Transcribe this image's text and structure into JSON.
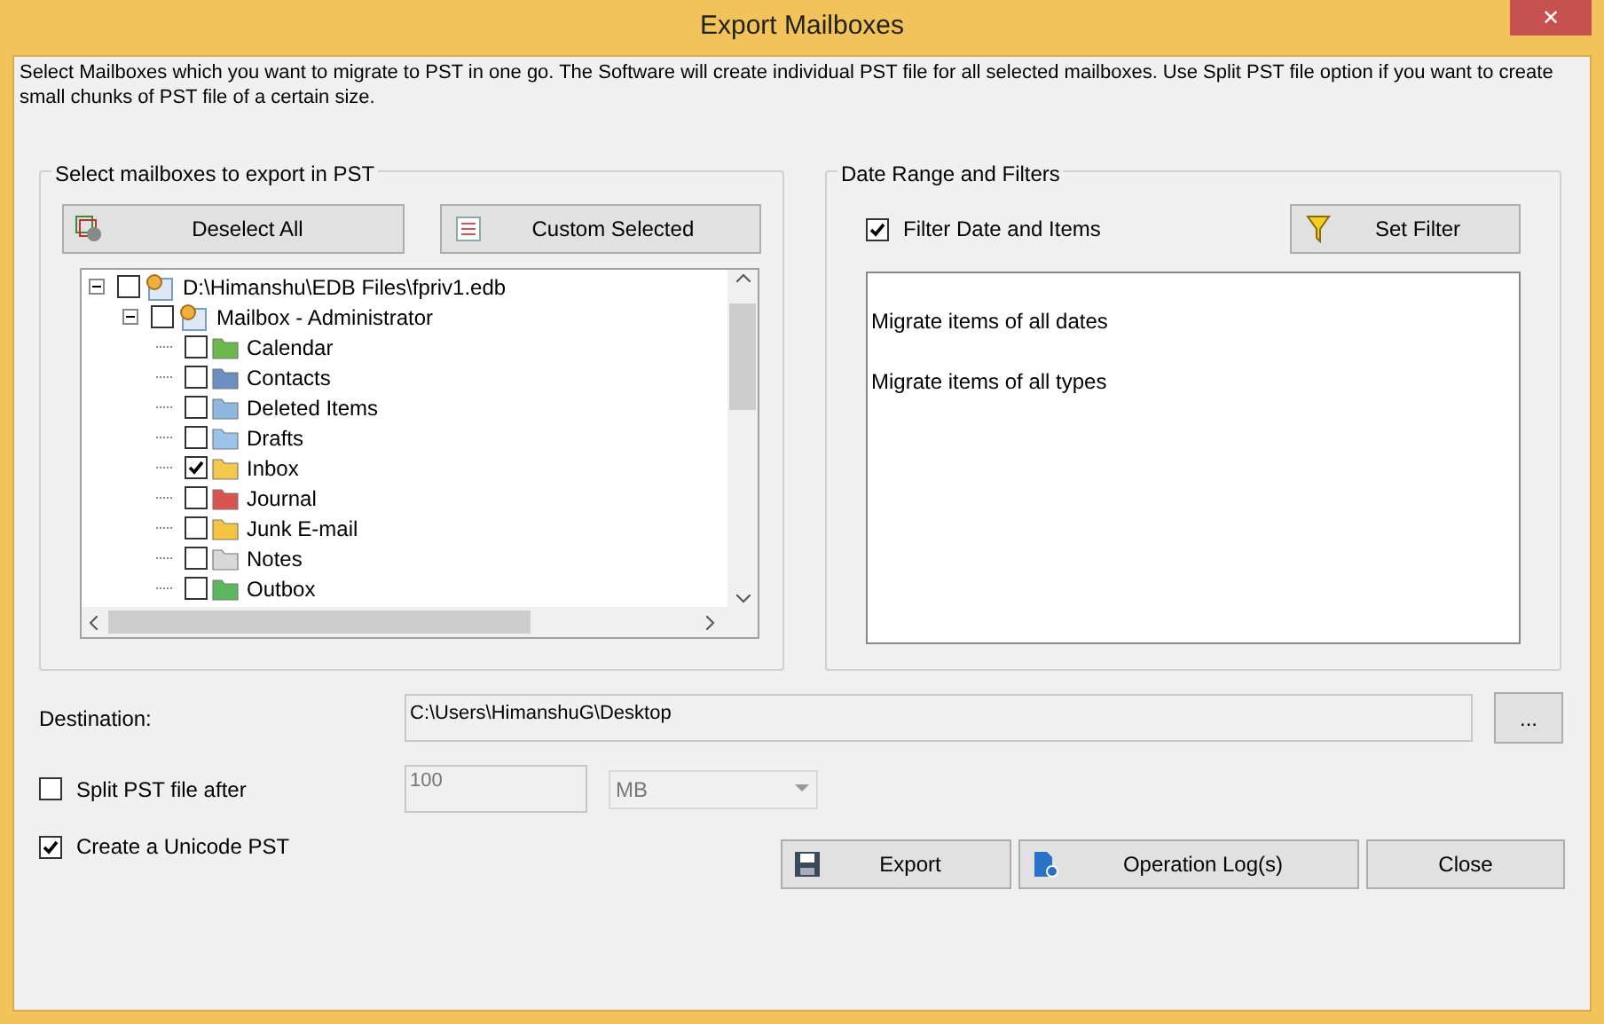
{
  "window": {
    "title": "Export Mailboxes",
    "close": "✕"
  },
  "description": "Select Mailboxes which you want to migrate to PST in one go. The Software will create individual PST file for all selected mailboxes. Use Split PST file option if you want to create small chunks of PST file of a certain size.",
  "mailbox_group": {
    "title": "Select mailboxes to export in PST",
    "buttons": [
      "Deselect All",
      "Custom Selected"
    ],
    "tree": [
      {
        "label": "D:\\Himanshu\\EDB Files\\fpriv1.edb",
        "checked": false,
        "expanded": true,
        "children": [
          {
            "label": "Mailbox - Administrator",
            "checked": false,
            "expanded": true,
            "children": [
              {
                "label": "Calendar",
                "checked": false
              },
              {
                "label": "Contacts",
                "checked": false
              },
              {
                "label": "Deleted Items",
                "checked": false
              },
              {
                "label": "Drafts",
                "checked": false
              },
              {
                "label": "Inbox",
                "checked": true
              },
              {
                "label": "Journal",
                "checked": false
              },
              {
                "label": "Junk E-mail",
                "checked": false
              },
              {
                "label": "Notes",
                "checked": false
              },
              {
                "label": "Outbox",
                "checked": false
              }
            ]
          }
        ]
      }
    ]
  },
  "filter_group": {
    "title": "Date Range and Filters",
    "filter_checkbox": {
      "label": "Filter Date and Items",
      "checked": true
    },
    "set_filter": "Set Filter",
    "summary": [
      "Migrate items of all dates",
      "Migrate items of all types"
    ]
  },
  "destination": {
    "label": "Destination:",
    "value": "C:\\Users\\HimanshuG\\Desktop",
    "browse": "..."
  },
  "split": {
    "label": "Split PST file after",
    "checked": false,
    "size": "100",
    "unit": "MB"
  },
  "unicode": {
    "label": "Create a Unicode PST",
    "checked": true
  },
  "actions": [
    "Export",
    "Operation Log(s)",
    "Close"
  ]
}
